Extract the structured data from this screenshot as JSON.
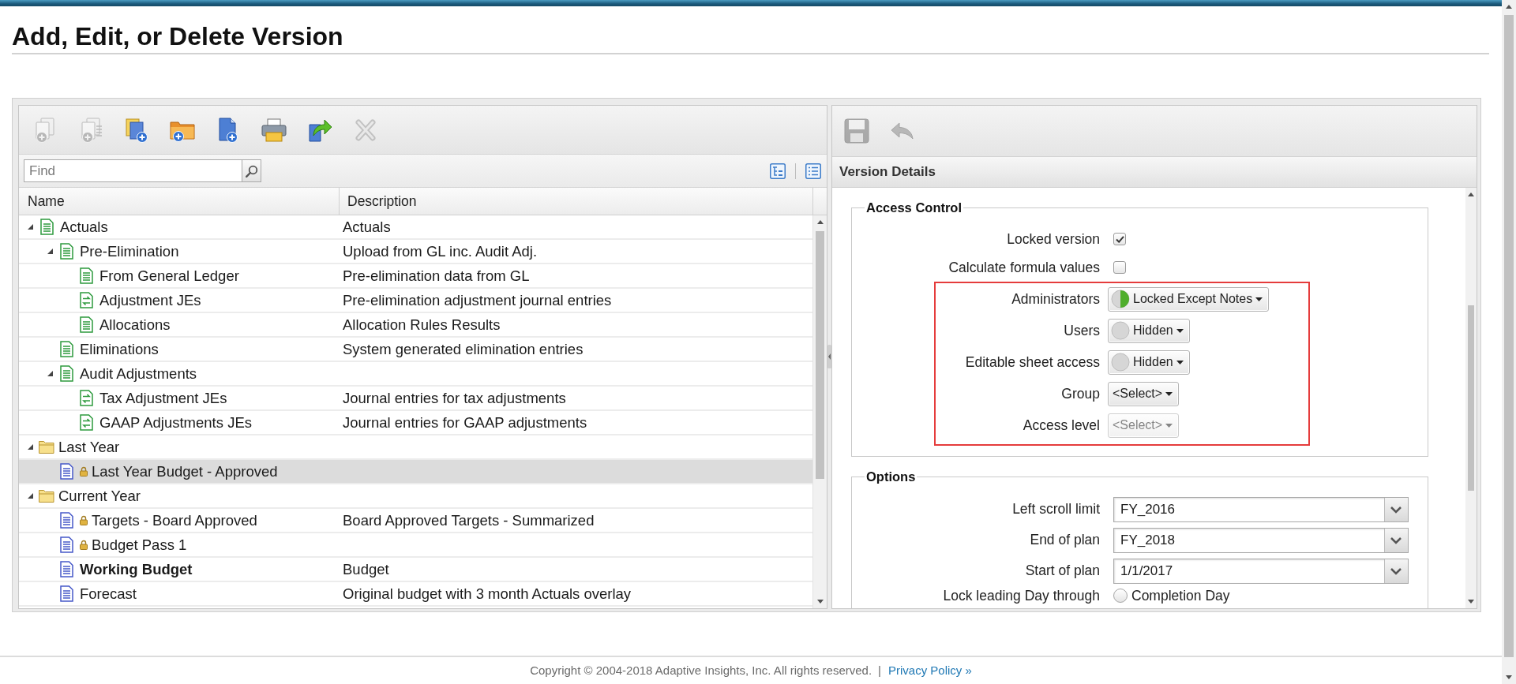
{
  "page": {
    "title": "Add, Edit, or Delete Version"
  },
  "versions_panel": {
    "toolbar": [
      {
        "kind": "copy",
        "disabled": true
      },
      {
        "kind": "copylist",
        "disabled": true
      },
      {
        "kind": "adddoc",
        "disabled": false
      },
      {
        "kind": "addfolder",
        "disabled": false
      },
      {
        "kind": "addpage",
        "disabled": false
      },
      {
        "kind": "print",
        "disabled": false
      },
      {
        "kind": "move",
        "disabled": false
      },
      {
        "kind": "delete",
        "disabled": true
      }
    ],
    "search": {
      "placeholder": "Find"
    },
    "columns": [
      "Name",
      "Description"
    ],
    "tree": [
      {
        "kind": "sheet",
        "name": "Actuals",
        "description": "Actuals",
        "expanded": true,
        "locked": false,
        "default": false,
        "selected": false,
        "children": [
          {
            "kind": "sheet",
            "name": "Pre-Elimination",
            "description": "Upload from GL inc. Audit Adj.",
            "expanded": true,
            "locked": false,
            "default": false,
            "selected": false,
            "children": [
              {
                "kind": "sheet",
                "name": "From General Ledger",
                "description": "Pre-elimination data from GL",
                "locked": false,
                "default": false,
                "selected": false
              },
              {
                "kind": "journal",
                "name": "Adjustment JEs",
                "description": "Pre-elimination adjustment journal entries",
                "locked": false,
                "default": false,
                "selected": false
              },
              {
                "kind": "sheet",
                "name": "Allocations",
                "description": "Allocation Rules Results",
                "locked": false,
                "default": false,
                "selected": false
              }
            ]
          },
          {
            "kind": "sheet",
            "name": "Eliminations",
            "description": "System generated elimination entries",
            "locked": false,
            "default": false,
            "selected": false
          },
          {
            "kind": "sheet",
            "name": "Audit Adjustments",
            "expanded": true,
            "locked": false,
            "default": false,
            "selected": false,
            "children": [
              {
                "kind": "journal",
                "name": "Tax Adjustment JEs",
                "description": "Journal entries for tax adjustments",
                "locked": false,
                "default": false,
                "selected": false
              },
              {
                "kind": "journal",
                "name": "GAAP Adjustments JEs",
                "description": "Journal entries for GAAP adjustments",
                "locked": false,
                "default": false,
                "selected": false
              }
            ]
          }
        ]
      },
      {
        "kind": "folder",
        "name": "Last Year",
        "expanded": true,
        "locked": false,
        "default": false,
        "selected": false,
        "children": [
          {
            "kind": "plan",
            "name": "Last Year Budget - Approved",
            "locked": true,
            "default": false,
            "selected": true
          }
        ]
      },
      {
        "kind": "folder",
        "name": "Current Year",
        "expanded": true,
        "locked": false,
        "default": false,
        "selected": false,
        "children": [
          {
            "kind": "plan",
            "name": "Targets - Board Approved",
            "description": "Board Approved Targets - Summarized",
            "locked": true,
            "default": false,
            "selected": false
          },
          {
            "kind": "plan",
            "name": "Budget Pass 1",
            "locked": true,
            "default": false,
            "selected": false
          },
          {
            "kind": "plan",
            "name": "Working Budget",
            "description": "Budget",
            "locked": false,
            "default": true,
            "selected": false
          },
          {
            "kind": "plan",
            "name": "Forecast",
            "description": "Original budget with 3 month Actuals overlay",
            "locked": false,
            "default": false,
            "selected": false
          }
        ]
      }
    ]
  },
  "details_panel": {
    "toolbar": [
      {
        "kind": "save",
        "disabled": true
      },
      {
        "kind": "undo",
        "disabled": true
      }
    ],
    "title": "Version Details",
    "access_control": {
      "legend": "Access Control",
      "fields": [
        {
          "kind": "checkbox",
          "label": "Locked version",
          "checked": true,
          "highlighted": false
        },
        {
          "kind": "checkbox",
          "label": "Calculate formula values",
          "checked": false,
          "highlighted": false
        },
        {
          "kind": "access",
          "label": "Administrators",
          "value": "Locked Except Notes",
          "partial": true,
          "highlighted": true
        },
        {
          "kind": "access",
          "label": "Users",
          "value": "Hidden",
          "partial": false,
          "highlighted": true
        },
        {
          "kind": "access",
          "label": "Editable sheet access",
          "value": "Hidden",
          "partial": false,
          "highlighted": true
        },
        {
          "kind": "select",
          "label": "Group",
          "value": "<Select>",
          "disabled": false,
          "highlighted": true
        },
        {
          "kind": "select",
          "label": "Access level",
          "value": "<Select>",
          "disabled": true,
          "highlighted": true
        }
      ]
    },
    "options": {
      "legend": "Options",
      "fields": [
        {
          "kind": "combo",
          "label": "Left scroll limit",
          "value": "FY_2016"
        },
        {
          "kind": "combo",
          "label": "End of plan",
          "value": "FY_2018"
        },
        {
          "kind": "combo",
          "label": "Start of plan",
          "value": "1/1/2017"
        },
        {
          "kind": "radio",
          "label": "Lock leading Day through",
          "option": "Completion Day",
          "selected": false
        }
      ]
    }
  },
  "footer": {
    "copyright": "Copyright © 2004-2018 Adaptive Insights, Inc. All rights reserved.",
    "separator": "|",
    "link": "Privacy Policy »"
  }
}
